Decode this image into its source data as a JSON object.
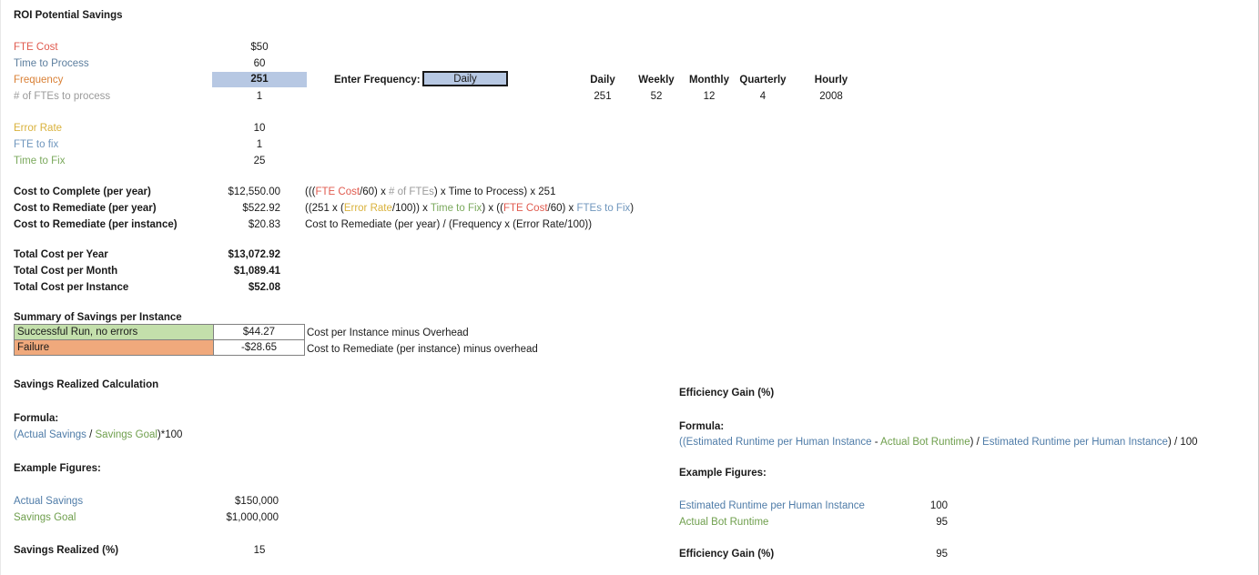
{
  "title": "ROI Potential Savings",
  "inputs": [
    {
      "label": "FTE Cost",
      "value": "$50",
      "color": "red"
    },
    {
      "label": "Time to Process",
      "value": "60",
      "color": "blue"
    },
    {
      "label": "Frequency",
      "value": "251",
      "color": "orange",
      "highlighted": true
    },
    {
      "label": "# of FTEs to process",
      "value": "1",
      "color": "gray"
    }
  ],
  "error_inputs": [
    {
      "label": "Error Rate",
      "value": "10",
      "color": "gold"
    },
    {
      "label": "FTE to fix",
      "value": "1",
      "color": "bluelt"
    },
    {
      "label": "Time to Fix",
      "value": "25",
      "color": "green"
    }
  ],
  "frequency_selector": {
    "label": "Enter Frequency:",
    "selected": "Daily",
    "options": [
      "Daily",
      "Weekly",
      "Monthly",
      "Quarterly",
      "Hourly"
    ]
  },
  "frequency_table": {
    "headers": [
      "Daily",
      "Weekly",
      "Monthly",
      "Quarterly",
      "Hourly"
    ],
    "values": [
      "251",
      "52",
      "12",
      "4",
      "2008"
    ]
  },
  "costs": [
    {
      "label": "Cost to Complete (per year)",
      "value": "$12,550.00",
      "formula_parts": [
        {
          "t": "(((",
          "c": "dark"
        },
        {
          "t": "FTE Cost",
          "c": "red"
        },
        {
          "t": "/60) x ",
          "c": "dark"
        },
        {
          "t": "# of FTEs",
          "c": "gray"
        },
        {
          "t": ") x ",
          "c": "dark"
        },
        {
          "t": "Time to Process",
          "c": "dark"
        },
        {
          "t": ") x 251",
          "c": "dark"
        }
      ]
    },
    {
      "label": "Cost to Remediate (per year)",
      "value": "$522.92",
      "formula_parts": [
        {
          "t": "((251 x (",
          "c": "dark"
        },
        {
          "t": "Error Rate",
          "c": "gold"
        },
        {
          "t": "/100)) x ",
          "c": "dark"
        },
        {
          "t": "Time to Fix",
          "c": "green"
        },
        {
          "t": ") x ((",
          "c": "dark"
        },
        {
          "t": "FTE Cost",
          "c": "red"
        },
        {
          "t": "/60) x ",
          "c": "dark"
        },
        {
          "t": "FTEs to Fix",
          "c": "bluelt"
        },
        {
          "t": ")",
          "c": "dark"
        }
      ]
    },
    {
      "label": "Cost to Remediate (per instance)",
      "value": "$20.83",
      "formula_parts": [
        {
          "t": "Cost to Remediate (per year) / (Frequency x (Error Rate/100))",
          "c": "dark"
        }
      ]
    }
  ],
  "totals": [
    {
      "label": "Total Cost per Year",
      "value": "$13,072.92"
    },
    {
      "label": "Total Cost per Month",
      "value": "$1,089.41"
    },
    {
      "label": "Total Cost per Instance",
      "value": "$52.08"
    }
  ],
  "summary": {
    "heading": "Summary of Savings per Instance",
    "rows": [
      {
        "label": "Successful Run, no errors",
        "value": "$44.27",
        "note": "Cost per Instance minus Overhead"
      },
      {
        "label": "Failure",
        "value": "-$28.65",
        "note": "Cost to Remediate (per instance) minus overhead"
      }
    ]
  },
  "savings_section": {
    "heading": "Savings Realized Calculation",
    "formula_label": "Formula:",
    "formula_parts": [
      {
        "t": "(",
        "c": "bluefm"
      },
      {
        "t": "Actual Savings",
        "c": "bluefm"
      },
      {
        "t": " / ",
        "c": "dark"
      },
      {
        "t": "Savings Goal",
        "c": "greenfm"
      },
      {
        "t": ")*100",
        "c": "dark"
      }
    ],
    "example_label": "Example Figures:",
    "examples": [
      {
        "label": "Actual Savings",
        "value": "$150,000",
        "color": "bluefm"
      },
      {
        "label": "Savings Goal",
        "value": "$1,000,000",
        "color": "greenfm"
      }
    ],
    "result_label": "Savings Realized (%)",
    "result_value": "15"
  },
  "efficiency_section": {
    "heading": "Efficiency Gain (%)",
    "formula_label": "Formula:",
    "formula_parts": [
      {
        "t": "((",
        "c": "bluefm"
      },
      {
        "t": "Estimated Runtime per Human Instance",
        "c": "bluefm"
      },
      {
        "t": " - ",
        "c": "dark"
      },
      {
        "t": "Actual Bot Runtime",
        "c": "greenfm"
      },
      {
        "t": ") / ",
        "c": "dark"
      },
      {
        "t": "Estimated Runtime per Human Instance",
        "c": "bluefm"
      },
      {
        "t": ") / 100",
        "c": "dark"
      }
    ],
    "example_label": "Example Figures:",
    "examples": [
      {
        "label": "Estimated Runtime per Human Instance",
        "value": "100",
        "color": "bluefm"
      },
      {
        "label": "Actual Bot Runtime",
        "value": "95",
        "color": "greenfm"
      }
    ],
    "result_label": "Efficiency Gain (%)",
    "result_value": "95"
  },
  "colors": {
    "highlight_fill": "#b7c8e3",
    "success_fill": "#c3dfab",
    "failure_fill": "#f0a97c",
    "red": "#e05a4e",
    "blue": "#5c7e9e",
    "orange": "#d98036",
    "gold": "#d9b23c",
    "green": "#7aa95c"
  }
}
